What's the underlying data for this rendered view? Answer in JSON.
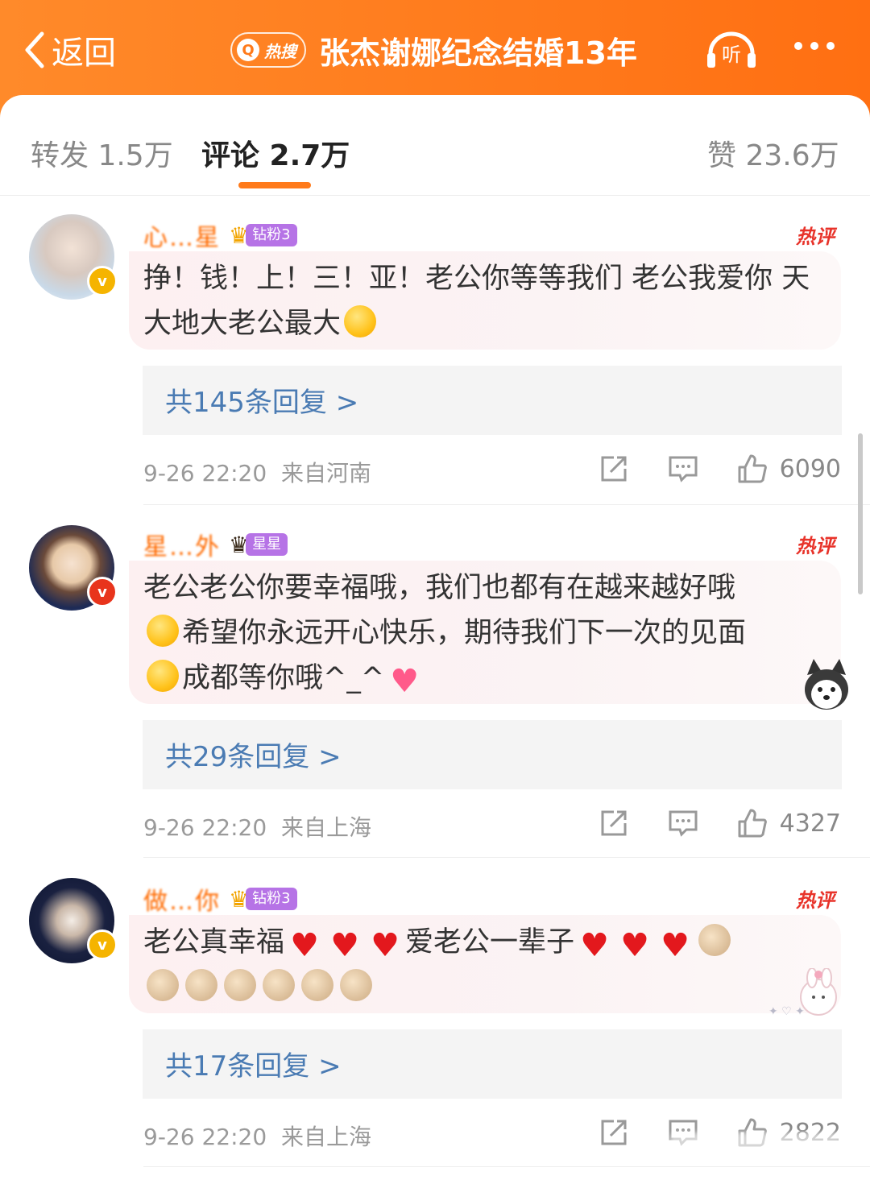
{
  "header": {
    "back_label": "返回",
    "hot_tag": "热搜",
    "topic_title": "张杰谢娜纪念结婚13年",
    "listen_label": "听"
  },
  "tabs": [
    {
      "label": "转发 1.5万"
    },
    {
      "label": "评论 2.7万"
    },
    {
      "label": "赞 23.6万"
    }
  ],
  "hot_label": "热评",
  "comments": [
    {
      "username": "心…星",
      "fan_badge": "钻粉3",
      "text_a": "挣！钱！上！三！亚！老公你等等我们 老公我爱你 天大地大老公最大",
      "replies": "共145条回复 >",
      "time": "9-26 22:20",
      "location": "来自河南",
      "likes": "6090"
    },
    {
      "username": "星…外",
      "fan_badge": "星星",
      "text_a": "老公老公你要幸福哦，我们也都有在越来越好哦",
      "text_b": "希望你永远开心快乐，期待我们下一次的见面",
      "text_c": "成都等你哦^_^",
      "replies": "共29条回复 >",
      "time": "9-26 22:20",
      "location": "来自上海",
      "likes": "4327"
    },
    {
      "username": "做…你",
      "fan_badge": "钻粉3",
      "text_a": "老公真幸福",
      "text_b": "爱老公一辈子",
      "replies": "共17条回复 >",
      "time": "9-26 22:20",
      "location": "来自上海",
      "likes": "2822"
    }
  ],
  "colors": {
    "header_orange": "#ff7a1a",
    "username": "#ff6a00",
    "reply_link": "#4a7bb3",
    "hot_red": "#e8332a",
    "fan_badge": "#b673e6"
  }
}
